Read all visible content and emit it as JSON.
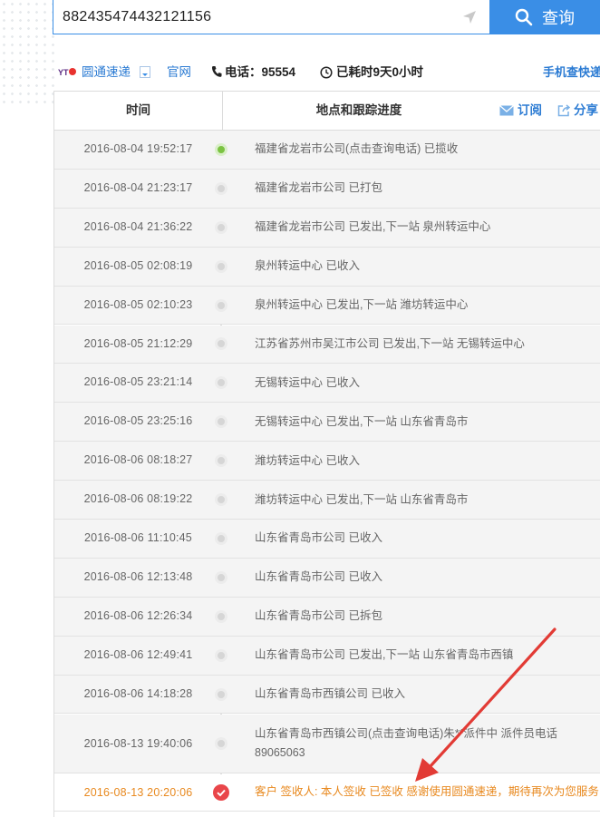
{
  "search": {
    "value": "882435474432121156",
    "button_label": "查询"
  },
  "info": {
    "company": "圆通速递",
    "official_site": "官网",
    "phone": "电话：95554",
    "elapsed": "已耗时9天0小时",
    "mobile_query": "手机查快递"
  },
  "table": {
    "col_time": "时间",
    "col_location": "地点和跟踪进度",
    "subscribe": "订阅",
    "share": "分享",
    "rows": [
      {
        "time": "2016-08-04 19:52:17",
        "desc": "福建省龙岩市公司(点击查询电话) 已揽收"
      },
      {
        "time": "2016-08-04 21:23:17",
        "desc": "福建省龙岩市公司 已打包"
      },
      {
        "time": "2016-08-04 21:36:22",
        "desc": "福建省龙岩市公司 已发出,下一站 泉州转运中心"
      },
      {
        "time": "2016-08-05 02:08:19",
        "desc": "泉州转运中心 已收入"
      },
      {
        "time": "2016-08-05 02:10:23",
        "desc": "泉州转运中心 已发出,下一站 潍坊转运中心"
      },
      {
        "time": "2016-08-05 21:12:29",
        "desc": "江苏省苏州市吴江市公司 已发出,下一站 无锡转运中心"
      },
      {
        "time": "2016-08-05 23:21:14",
        "desc": "无锡转运中心 已收入"
      },
      {
        "time": "2016-08-05 23:25:16",
        "desc": "无锡转运中心 已发出,下一站 山东省青岛市"
      },
      {
        "time": "2016-08-06 08:18:27",
        "desc": "潍坊转运中心 已收入"
      },
      {
        "time": "2016-08-06 08:19:22",
        "desc": "潍坊转运中心 已发出,下一站 山东省青岛市"
      },
      {
        "time": "2016-08-06 11:10:45",
        "desc": "山东省青岛市公司 已收入"
      },
      {
        "time": "2016-08-06 12:13:48",
        "desc": "山东省青岛市公司 已收入"
      },
      {
        "time": "2016-08-06 12:26:34",
        "desc": "山东省青岛市公司 已拆包"
      },
      {
        "time": "2016-08-06 12:49:41",
        "desc": "山东省青岛市公司 已发出,下一站 山东省青岛市西镇"
      },
      {
        "time": "2016-08-06 14:18:28",
        "desc": "山东省青岛市西镇公司 已收入"
      },
      {
        "time": "2016-08-13 19:40:06",
        "desc": "山东省青岛市西镇公司(点击查询电话)朱**派件中 派件员电话 89065063"
      },
      {
        "time": "2016-08-13 20:20:06",
        "desc": "客户 签收人: 本人签收 已签收 感谢使用圆通速递，期待再次为您服务"
      }
    ]
  },
  "colors": {
    "accent": "#3a8ee6",
    "link": "#2b7bd3",
    "signed": "#e8891f",
    "arrow": "#e23b35"
  }
}
